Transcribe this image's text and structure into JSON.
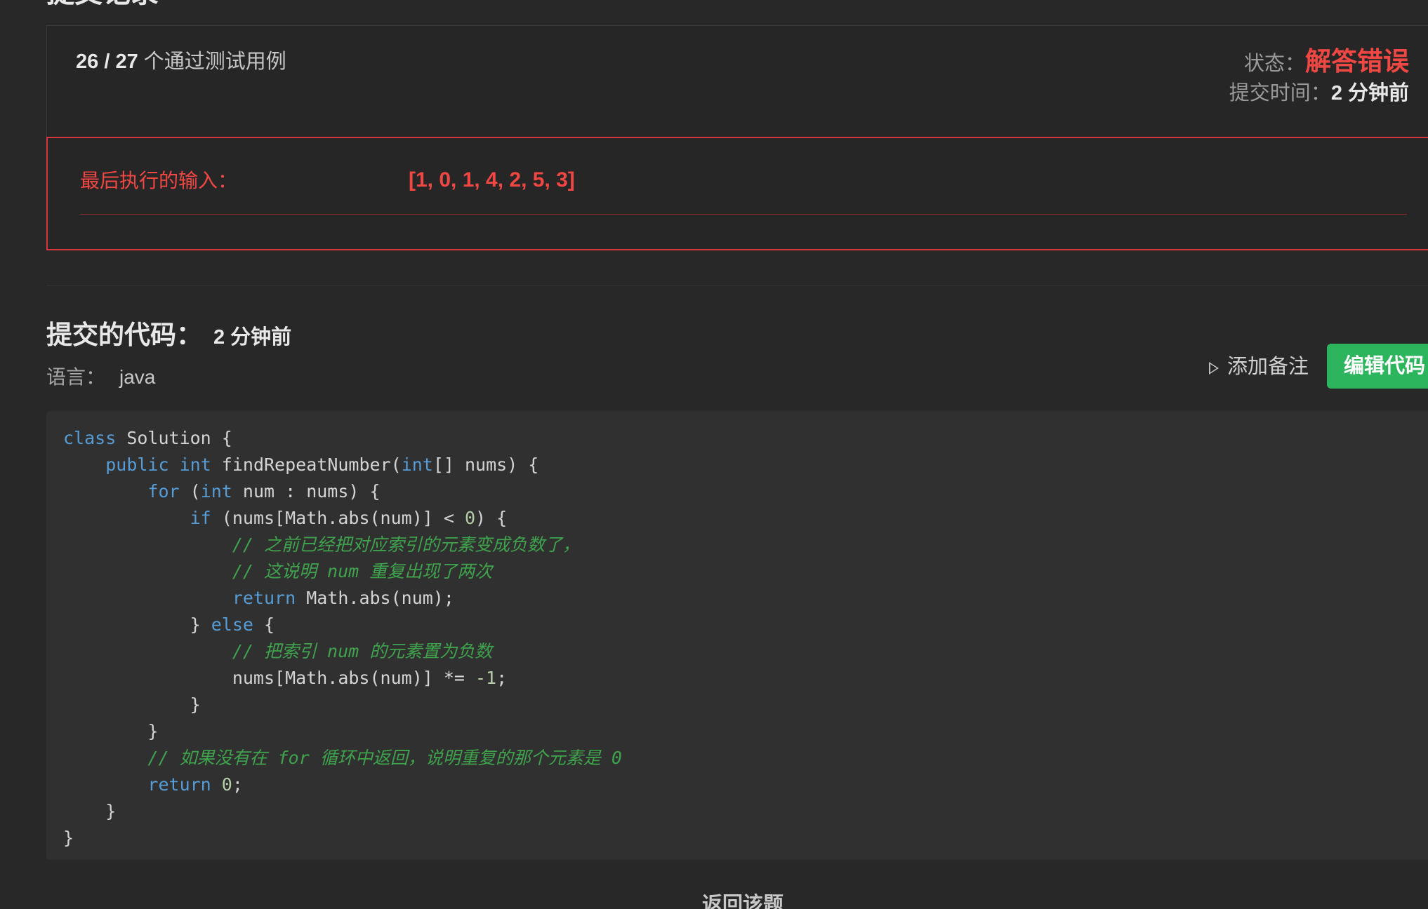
{
  "page": {
    "title": "提交记录"
  },
  "result": {
    "passed": "26",
    "total": "27",
    "separator": " / ",
    "cases_label": "个通过测试用例",
    "status_label": "状态：",
    "status_value": "解答错误",
    "submit_time_label": "提交时间：",
    "submit_time_value": "2 分钟前",
    "status_color": "#ef4743"
  },
  "error": {
    "last_input_label": "最后执行的输入：",
    "last_input_value": "[1, 0, 1, 4, 2, 5, 3]"
  },
  "submission": {
    "title": "提交的代码：",
    "time": "2 分钟前",
    "language_label": "语言：",
    "language_value": "java",
    "add_note_label": "添加备注",
    "add_note_icon": "play-outline-icon",
    "edit_code_label": "编辑代码",
    "edit_code_color": "#2db55d"
  },
  "code": {
    "language": "java",
    "lines": [
      "class Solution {",
      "    public int findRepeatNumber(int[] nums) {",
      "        for (int num : nums) {",
      "            if (nums[Math.abs(num)] < 0) {",
      "                // 之前已经把对应索引的元素变成负数了，",
      "                // 这说明 num 重复出现了两次",
      "                return Math.abs(num);",
      "            } else {",
      "                // 把索引 num 的元素置为负数",
      "                nums[Math.abs(num)] *= -1;",
      "            }",
      "        }",
      "        // 如果没有在 for 循环中返回，说明重复的那个元素是 0",
      "        return 0;",
      "    }",
      "}"
    ]
  },
  "footer": {
    "back_label": "返回该题"
  }
}
